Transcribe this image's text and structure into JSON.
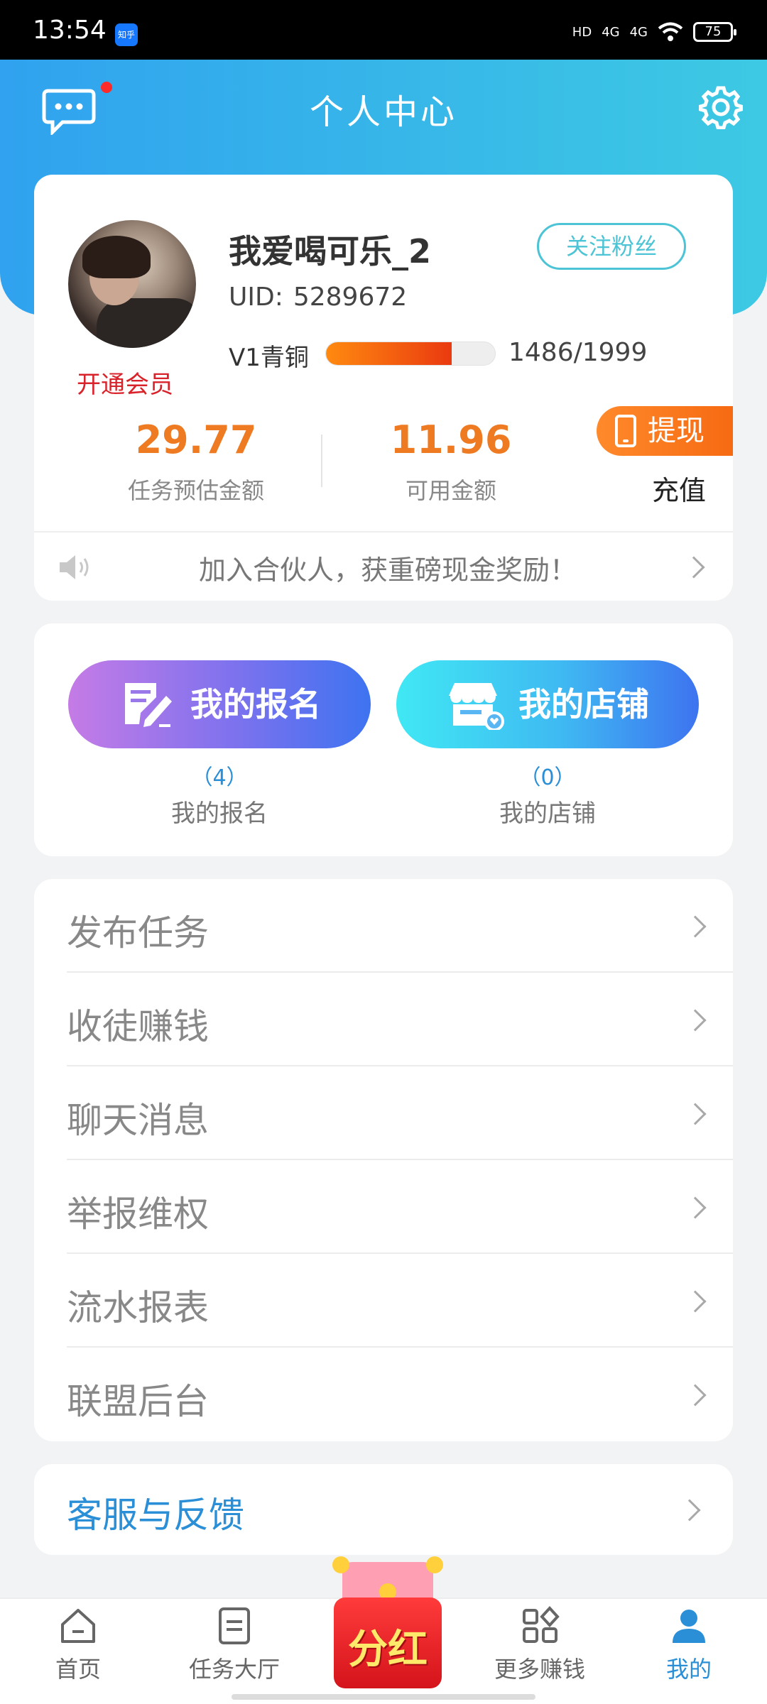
{
  "status_bar": {
    "time": "13:54",
    "app_badge": "知乎",
    "signal1": "4G",
    "signal2": "4G",
    "battery": "75"
  },
  "header": {
    "title": "个人中心"
  },
  "profile": {
    "username": "我爱喝可乐_2",
    "uid_label": "UID:",
    "uid_value": "5289672",
    "follow_label": "关注粉丝",
    "vip_label": "开通会员",
    "level_name": "V1青铜",
    "level_progress": 0.743,
    "level_text": "1486/1999"
  },
  "wallet": {
    "estimated_amount": "29.77",
    "estimated_label": "任务预估金额",
    "available_amount": "11.96",
    "available_label": "可用金额",
    "withdraw_label": "提现",
    "recharge_label": "充值"
  },
  "notice": {
    "text": "加入合伙人，获重磅现金奖励！"
  },
  "shortcuts": {
    "signup": {
      "button": "我的报名",
      "count": "（4）",
      "caption": "我的报名"
    },
    "store": {
      "button": "我的店铺",
      "count": "（0）",
      "caption": "我的店铺"
    }
  },
  "menu": {
    "items": [
      {
        "label": "发布任务"
      },
      {
        "label": "收徒赚钱"
      },
      {
        "label": "聊天消息"
      },
      {
        "label": "举报维权"
      },
      {
        "label": "流水报表"
      },
      {
        "label": "联盟后台"
      }
    ]
  },
  "support": {
    "label": "客服与反馈"
  },
  "tabbar": {
    "items": [
      {
        "label": "首页"
      },
      {
        "label": "任务大厅"
      },
      {
        "label": "分红"
      },
      {
        "label": "更多赚钱"
      },
      {
        "label": "我的"
      }
    ]
  },
  "colors": {
    "accent": "#2a8fd6",
    "amount": "#ee7a22",
    "vip": "#d9232b",
    "header_start": "#30a2ef",
    "header_end": "#3dc9e3"
  }
}
